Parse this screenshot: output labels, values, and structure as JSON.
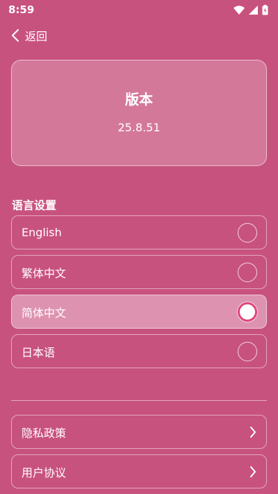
{
  "status_bar": {
    "time": "8:59"
  },
  "nav": {
    "back_label": "返回"
  },
  "version": {
    "title": "版本",
    "number": "25.8.51"
  },
  "language_section": {
    "title": "语言设置",
    "options": [
      {
        "label": "English",
        "selected": false
      },
      {
        "label": "繁体中文",
        "selected": false
      },
      {
        "label": "简体中文",
        "selected": true
      },
      {
        "label": "日本语",
        "selected": false
      }
    ]
  },
  "links": [
    {
      "label": "隐私政策"
    },
    {
      "label": "用户协议"
    }
  ],
  "colors": {
    "background": "#c8527e",
    "radio_accent": "#e0457a"
  }
}
